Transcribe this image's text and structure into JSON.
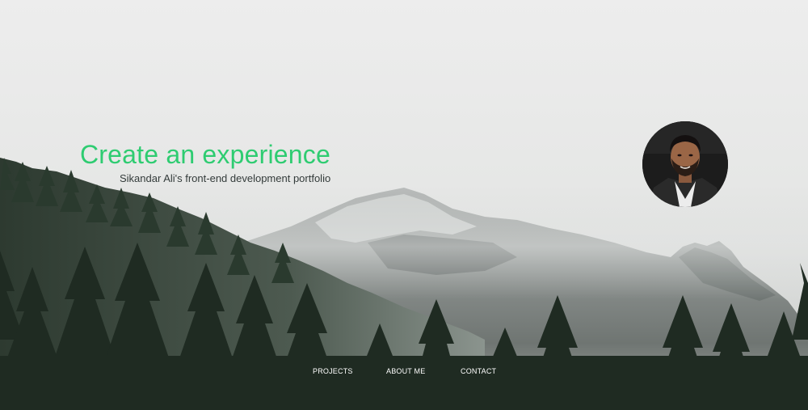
{
  "hero": {
    "headline": "Create an experience",
    "tagline": "Sikandar Ali's front-end development portfolio",
    "accent_color": "#2ecc71",
    "background": "misty-mountain-forest-photo"
  },
  "profile": {
    "avatar": "profile-photo"
  },
  "nav": {
    "items": [
      {
        "label": "PROJECTS"
      },
      {
        "label": "ABOUT ME"
      },
      {
        "label": "CONTACT"
      }
    ]
  }
}
